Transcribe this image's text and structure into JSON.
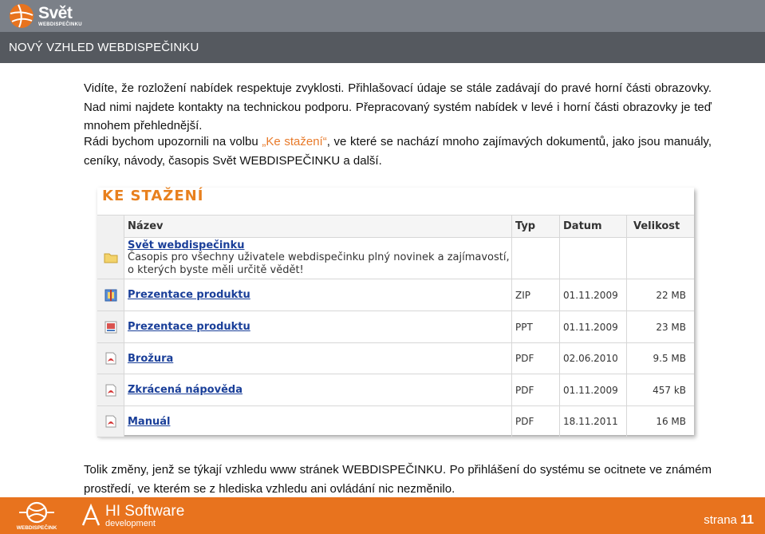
{
  "header": {
    "logo_main": "Svět",
    "logo_sub": "WEBDISPEČINKU",
    "section_title": "NOVÝ VZHLED WEBDISPEČINKU"
  },
  "body": {
    "p1": "Vidíte, že rozložení nabídek respektuje zvyklosti. Přihlašovací údaje se stále zadávají do pravé horní části obrazovky. Nad nimi najdete kontakty na technickou podporu. Přepracovaný systém nabídek v levé i horní části obrazovky je teď mnohem přehlednější.",
    "p2_before": "Rádi bychom upozornili na volbu ",
    "p2_highlight": "„Ke stažení“",
    "p2_after": ", ve které se nachází mnoho zajímavých dokumentů, jako jsou manuály, ceníky, návody, časopis Svět WEBDISPEČINKU a další.",
    "p3": "Tolik změny, jenž se týkají vzhledu www stránek WEBDISPEČINKU. Po přihlášení do systému se ocitnete ve známém prostředí, ve kterém se z hlediska vzhledu ani ovládání nic nezměnilo."
  },
  "downloads": {
    "title": "KE STAŽENÍ",
    "columns": [
      "Název",
      "Typ",
      "Datum",
      "Velikost"
    ],
    "rows": [
      {
        "icon": "folder-icon",
        "name": "Svět webdispečinku",
        "desc": "Časopis pro všechny uživatele webdispečinku plný novinek a zajímavostí, o kterých byste měli určitě vědět!",
        "type": "",
        "date": "",
        "size": ""
      },
      {
        "icon": "zip-file-icon",
        "name": "Prezentace produktu",
        "desc": "",
        "type": "ZIP",
        "date": "01.11.2009",
        "size": "22 MB"
      },
      {
        "icon": "ppt-file-icon",
        "name": "Prezentace produktu",
        "desc": "",
        "type": "PPT",
        "date": "01.11.2009",
        "size": "23 MB"
      },
      {
        "icon": "pdf-file-icon",
        "name": "Brožura",
        "desc": "",
        "type": "PDF",
        "date": "02.06.2010",
        "size": "9.5 MB"
      },
      {
        "icon": "pdf-file-icon",
        "name": "Zkrácená nápověda",
        "desc": "",
        "type": "PDF",
        "date": "01.11.2009",
        "size": "457 kB"
      },
      {
        "icon": "pdf-file-icon",
        "name": "Manuál",
        "desc": "",
        "type": "PDF",
        "date": "18.11.2011",
        "size": "16 MB"
      }
    ]
  },
  "footer": {
    "webdispecink_logo": "WEBDISPEČINK",
    "hi_main": "HI Software",
    "hi_sub": "development",
    "page_label": "strana",
    "page_number": "11"
  },
  "colors": {
    "accent": "#e8731e",
    "link": "#1a3f99",
    "header_bar": "#55595f"
  }
}
